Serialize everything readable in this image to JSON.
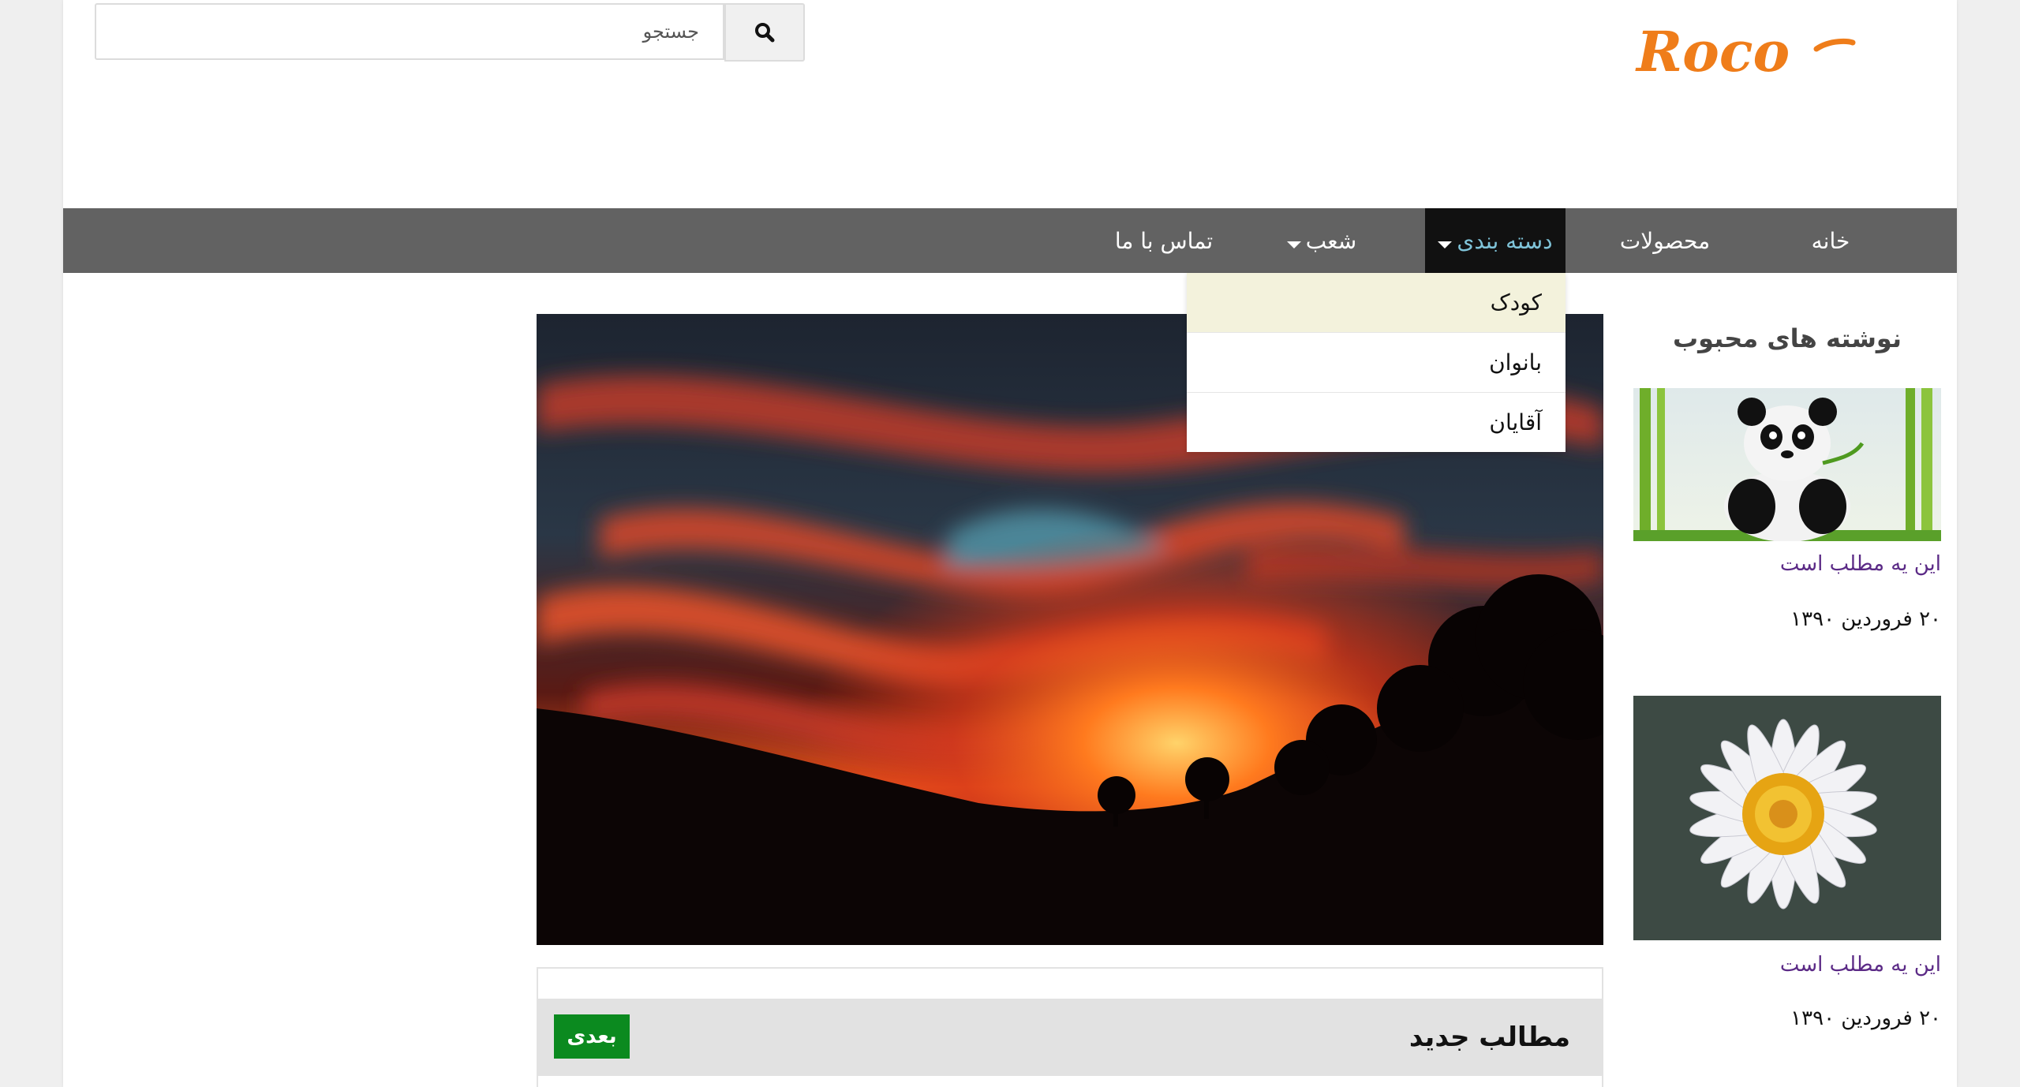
{
  "header": {
    "search": {
      "placeholder": "جستجو",
      "value": ""
    },
    "logo_text": "Roco"
  },
  "nav": {
    "items": [
      {
        "label": "خانه"
      },
      {
        "label": "محصولات"
      },
      {
        "label": "دسته بندی",
        "has_dropdown": true,
        "active": true
      },
      {
        "label": "شعب",
        "has_dropdown": true
      },
      {
        "label": "تماس با ما"
      }
    ],
    "dropdown": {
      "items": [
        {
          "label": "کودک",
          "hovered": true
        },
        {
          "label": "بانوان"
        },
        {
          "label": "آقایان"
        }
      ]
    }
  },
  "main": {
    "new_posts_title": "مطالب جدید",
    "next_label": "بعدی"
  },
  "sidebar": {
    "title": "نوشته های محبوب",
    "posts": [
      {
        "title": "این یه مطلب است",
        "date": "۲۰ فروردین ۱۳۹۰"
      },
      {
        "title": "این یه مطلب است",
        "date": "۲۰ فروردین ۱۳۹۰"
      }
    ]
  },
  "colors": {
    "nav_bg": "#626262",
    "nav_active_bg": "#111111",
    "nav_active_text": "#7fc3d8",
    "logo": "#ef7d1a",
    "next_button": "#0b8a1f",
    "link": "#5b2a86",
    "dropdown_hover": "#f3f2dc"
  }
}
